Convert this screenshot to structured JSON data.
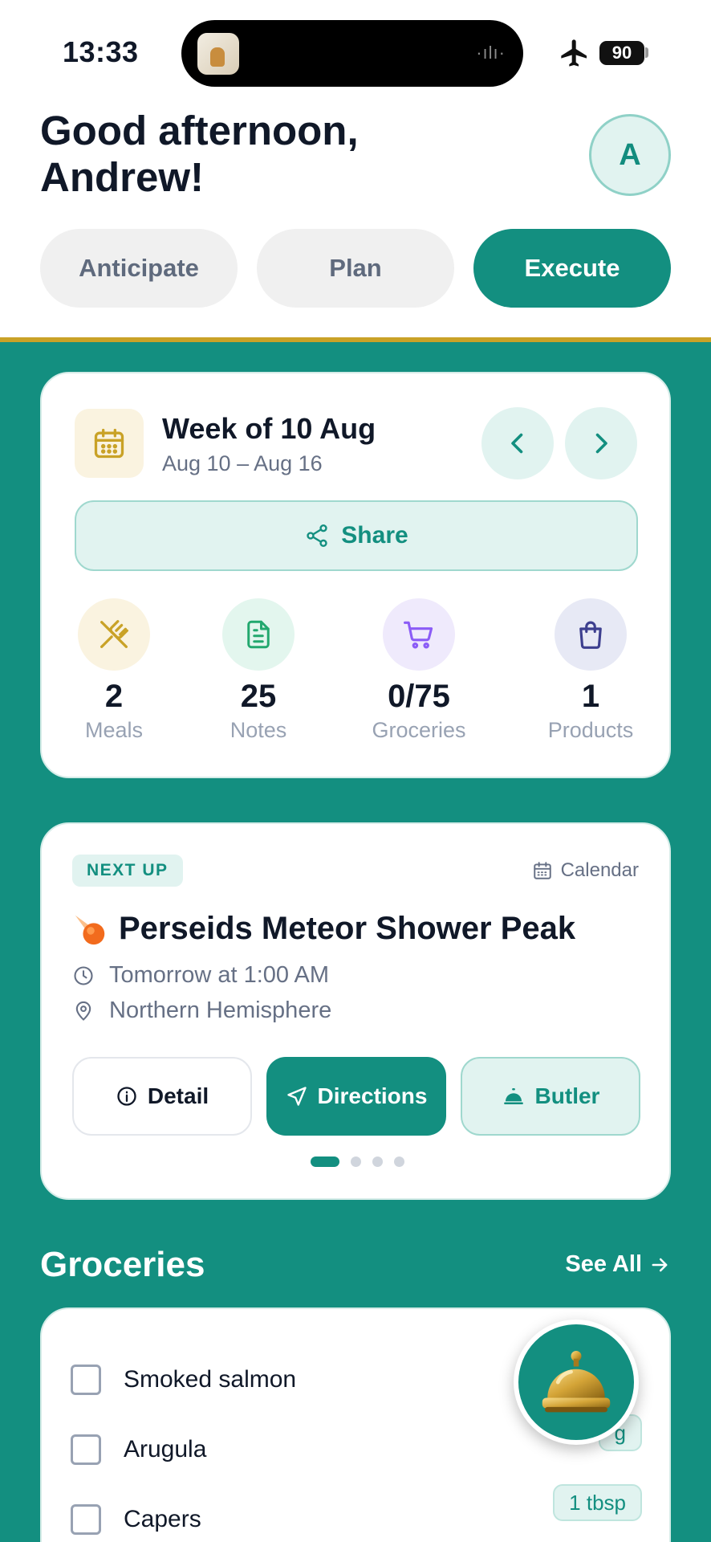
{
  "status_bar": {
    "time": "13:33",
    "battery": "90"
  },
  "header": {
    "greeting": "Good afternoon,\nAndrew!",
    "avatar_initial": "A"
  },
  "tabs": [
    {
      "label": "Anticipate",
      "active": false
    },
    {
      "label": "Plan",
      "active": false
    },
    {
      "label": "Execute",
      "active": true
    }
  ],
  "week_card": {
    "title": "Week of 10 Aug",
    "range": "Aug 10 – Aug 16",
    "share_label": "Share",
    "stats": [
      {
        "value": "2",
        "label": "Meals",
        "icon": "utensils-icon"
      },
      {
        "value": "25",
        "label": "Notes",
        "icon": "document-icon"
      },
      {
        "value": "0/75",
        "label": "Groceries",
        "icon": "cart-icon"
      },
      {
        "value": "1",
        "label": "Products",
        "icon": "bag-icon"
      }
    ]
  },
  "next_up": {
    "badge": "NEXT UP",
    "calendar_label": "Calendar",
    "title": "Perseids Meteor Shower Peak",
    "time": "Tomorrow at 1:00 AM",
    "location": "Northern Hemisphere",
    "actions": {
      "detail": "Detail",
      "directions": "Directions",
      "butler": "Butler"
    },
    "page_count": 4,
    "current_page": 1
  },
  "groceries": {
    "title": "Groceries",
    "see_all": "See All",
    "items": [
      {
        "name": "Smoked salmon",
        "qty": ""
      },
      {
        "name": "Arugula",
        "qty": "g"
      },
      {
        "name": "Capers",
        "qty": "1 tbsp"
      }
    ]
  },
  "colors": {
    "accent": "#138f80",
    "gold": "#c9a227",
    "light_accent": "#e1f3f0"
  }
}
